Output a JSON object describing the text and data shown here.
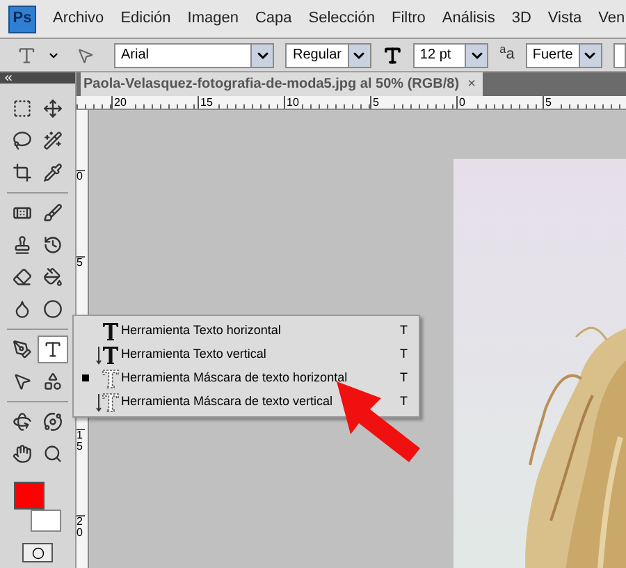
{
  "app_logo": "Ps",
  "menu": [
    "Archivo",
    "Edición",
    "Imagen",
    "Capa",
    "Selección",
    "Filtro",
    "Análisis",
    "3D",
    "Vista",
    "Ven"
  ],
  "options_bar": {
    "font_family": "Arial",
    "font_style": "Regular",
    "font_size": "12 pt",
    "antialias_label": "$^{a}$a",
    "antialias": "Fuerte"
  },
  "document_tab": {
    "title": "Paola-Velasquez-fotografia-de-moda5.jpg al 50% (RGB/8)",
    "close": "×"
  },
  "ruler_h": [
    "20",
    "15",
    "10",
    "5",
    "0",
    "5"
  ],
  "ruler_v": [
    {
      "label": "0",
      "kind": "tick"
    },
    {
      "label": "5",
      "kind": "tick"
    },
    {
      "kind": "gap"
    },
    {
      "label": "15",
      "kind": "tick"
    },
    {
      "label": "20",
      "kind": "tick"
    }
  ],
  "tools": [
    {
      "kind": "marquee",
      "selected": false
    },
    {
      "kind": "move",
      "selected": false
    },
    {
      "kind": "lasso",
      "selected": false
    },
    {
      "kind": "wand",
      "selected": false
    },
    {
      "kind": "crop",
      "selected": false
    },
    {
      "kind": "eyedropper",
      "selected": false
    },
    {
      "kind": "heal",
      "selected": false
    },
    {
      "kind": "brush",
      "selected": false
    },
    {
      "kind": "stamp",
      "selected": false
    },
    {
      "kind": "history",
      "selected": false
    },
    {
      "kind": "eraser",
      "selected": false
    },
    {
      "kind": "bucket",
      "selected": false
    },
    {
      "kind": "blur",
      "selected": false
    },
    {
      "kind": "dodge",
      "selected": false
    },
    {
      "kind": "pen",
      "selected": false
    },
    {
      "kind": "type",
      "selected": true
    },
    {
      "kind": "select",
      "selected": false
    },
    {
      "kind": "shape",
      "selected": false
    },
    {
      "kind": "rotate3d",
      "selected": false
    },
    {
      "kind": "orbit",
      "selected": false
    },
    {
      "kind": "hand",
      "selected": false
    },
    {
      "kind": "zoom",
      "selected": false
    }
  ],
  "color_swatches": [
    {
      "kind": "foreground",
      "color": "#ff0000"
    },
    {
      "kind": "background",
      "color": "#ffffff"
    }
  ],
  "flyout": [
    {
      "kind": "horizontal",
      "label": "Herramienta Texto horizontal",
      "shortcut": "T",
      "selected": false
    },
    {
      "kind": "vertical",
      "label": "Herramienta Texto vertical",
      "shortcut": "T",
      "selected": false
    },
    {
      "kind": "mask-horizontal",
      "label": "Herramienta Máscara de texto horizontal",
      "shortcut": "T",
      "selected": true
    },
    {
      "kind": "mask-vertical",
      "label": "Herramienta Máscara de texto vertical",
      "shortcut": "T",
      "selected": false
    }
  ]
}
